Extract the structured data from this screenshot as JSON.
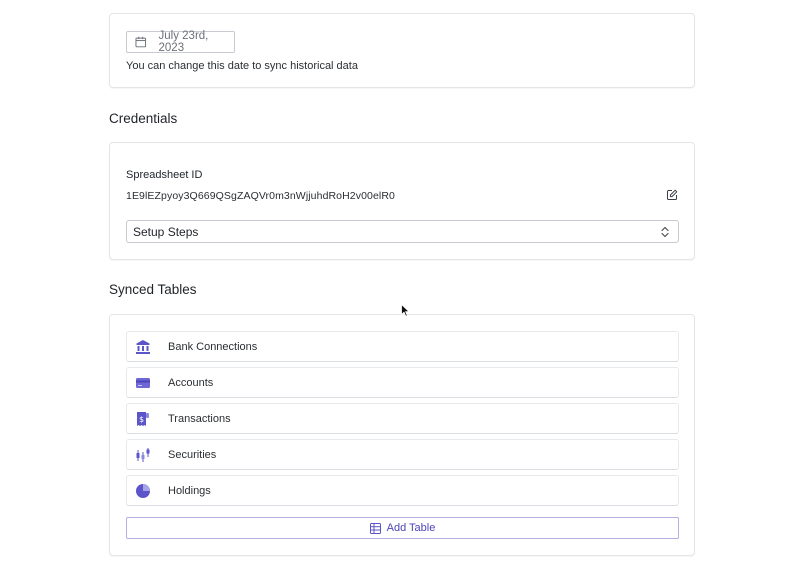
{
  "date_section": {
    "date_value": "July 23rd, 2023",
    "help_text": "You can change this date to sync historical data"
  },
  "credentials": {
    "title": "Credentials",
    "spreadsheet_label": "Spreadsheet ID",
    "spreadsheet_id": "1E9lEZpyoy3Q669QSgZAQVr0m3nWjjuhdRoH2v00elR0",
    "setup_steps_label": "Setup Steps"
  },
  "synced_tables": {
    "title": "Synced Tables",
    "items": [
      {
        "label": "Bank Connections",
        "icon": "bank-icon"
      },
      {
        "label": "Accounts",
        "icon": "card-icon"
      },
      {
        "label": "Transactions",
        "icon": "receipt-icon"
      },
      {
        "label": "Securities",
        "icon": "candlestick-icon"
      },
      {
        "label": "Holdings",
        "icon": "pie-chart-icon"
      }
    ],
    "add_label": "Add Table"
  },
  "colors": {
    "accent": "#5b55c9",
    "border": "#e3e5e8"
  }
}
